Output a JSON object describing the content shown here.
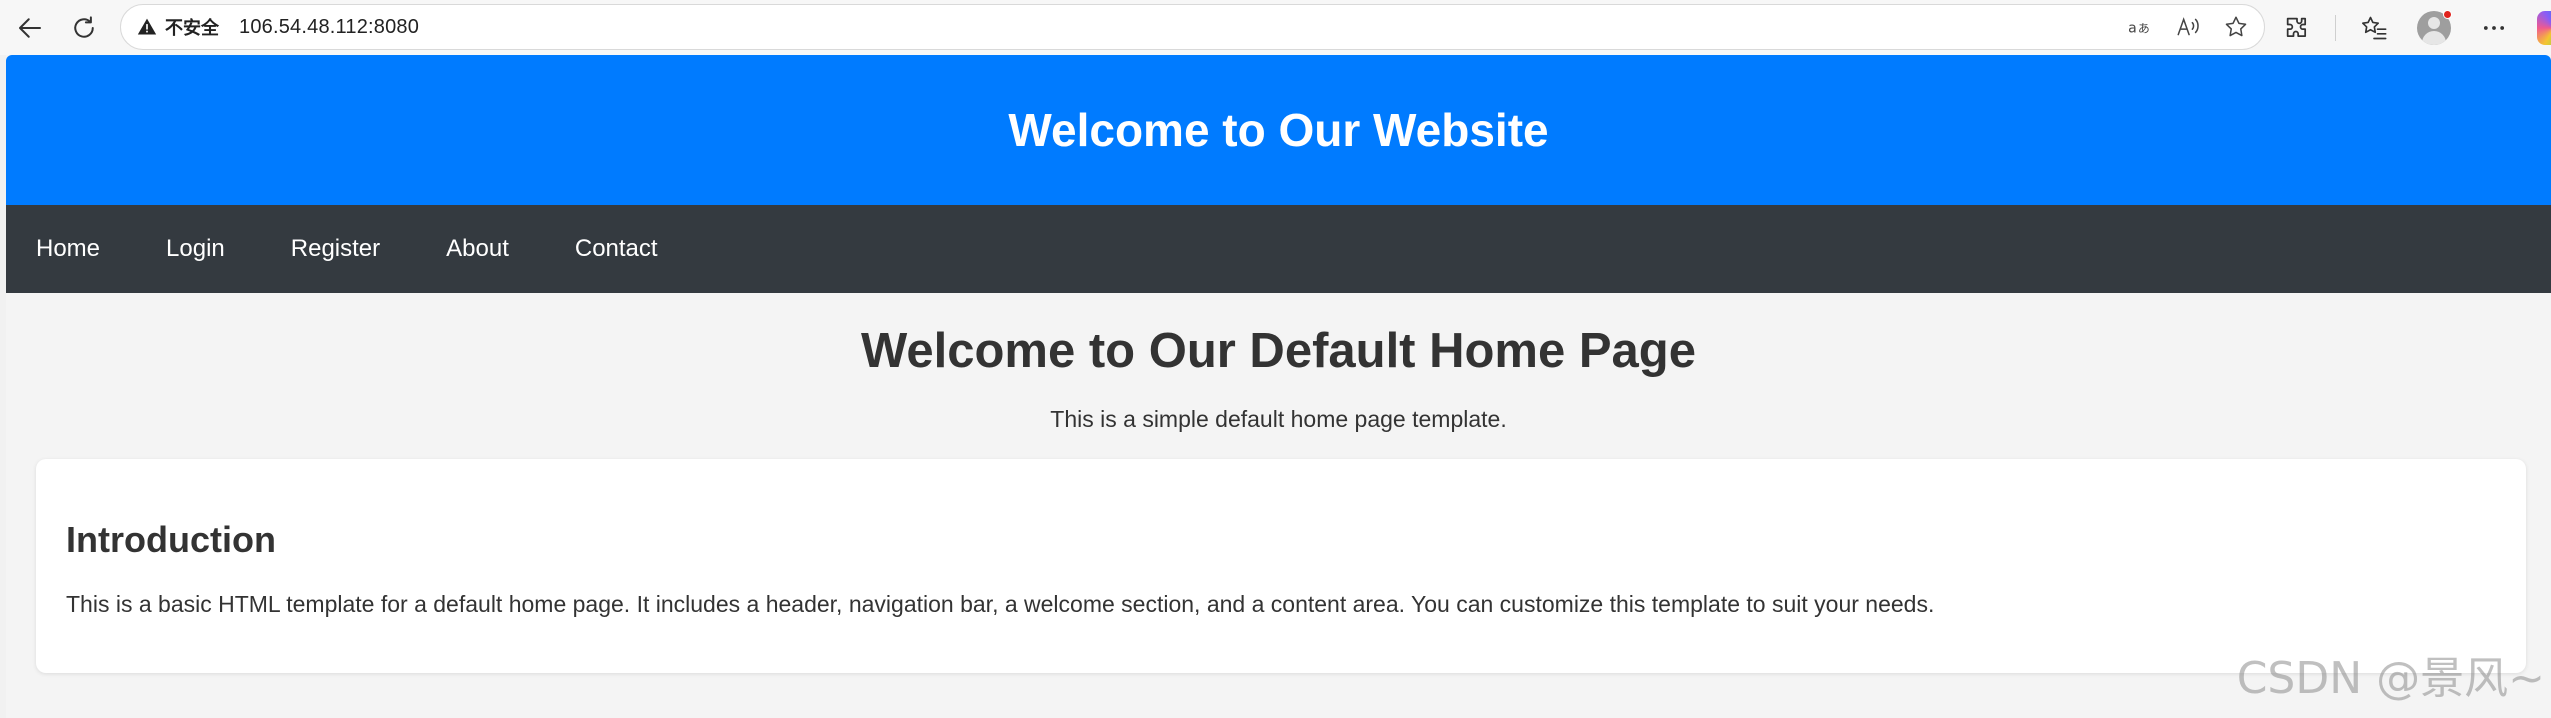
{
  "browser": {
    "security_label": "不安全",
    "url": "106.54.48.112:8080"
  },
  "site": {
    "header_title": "Welcome to Our Website",
    "nav": [
      "Home",
      "Login",
      "Register",
      "About",
      "Contact"
    ],
    "welcome": {
      "heading": "Welcome to Our Default Home Page",
      "subtitle": "This is a simple default home page template."
    },
    "intro": {
      "heading": "Introduction",
      "text": "This is a basic HTML template for a default home page. It includes a header, navigation bar, a welcome section, and a content area. You can customize this template to suit your needs."
    }
  },
  "watermark": "CSDN @景风~",
  "colors": {
    "header_bg": "#007bff",
    "nav_bg": "#343a40",
    "page_bg": "#f4f4f4",
    "text": "#333333"
  },
  "icons": [
    "back-arrow-icon",
    "reload-icon",
    "warning-icon",
    "read-aloud-icon",
    "translate-icon",
    "favorite-star-icon",
    "extensions-icon",
    "favorites-list-icon",
    "profile-avatar",
    "more-menu-icon",
    "copilot-icon"
  ]
}
